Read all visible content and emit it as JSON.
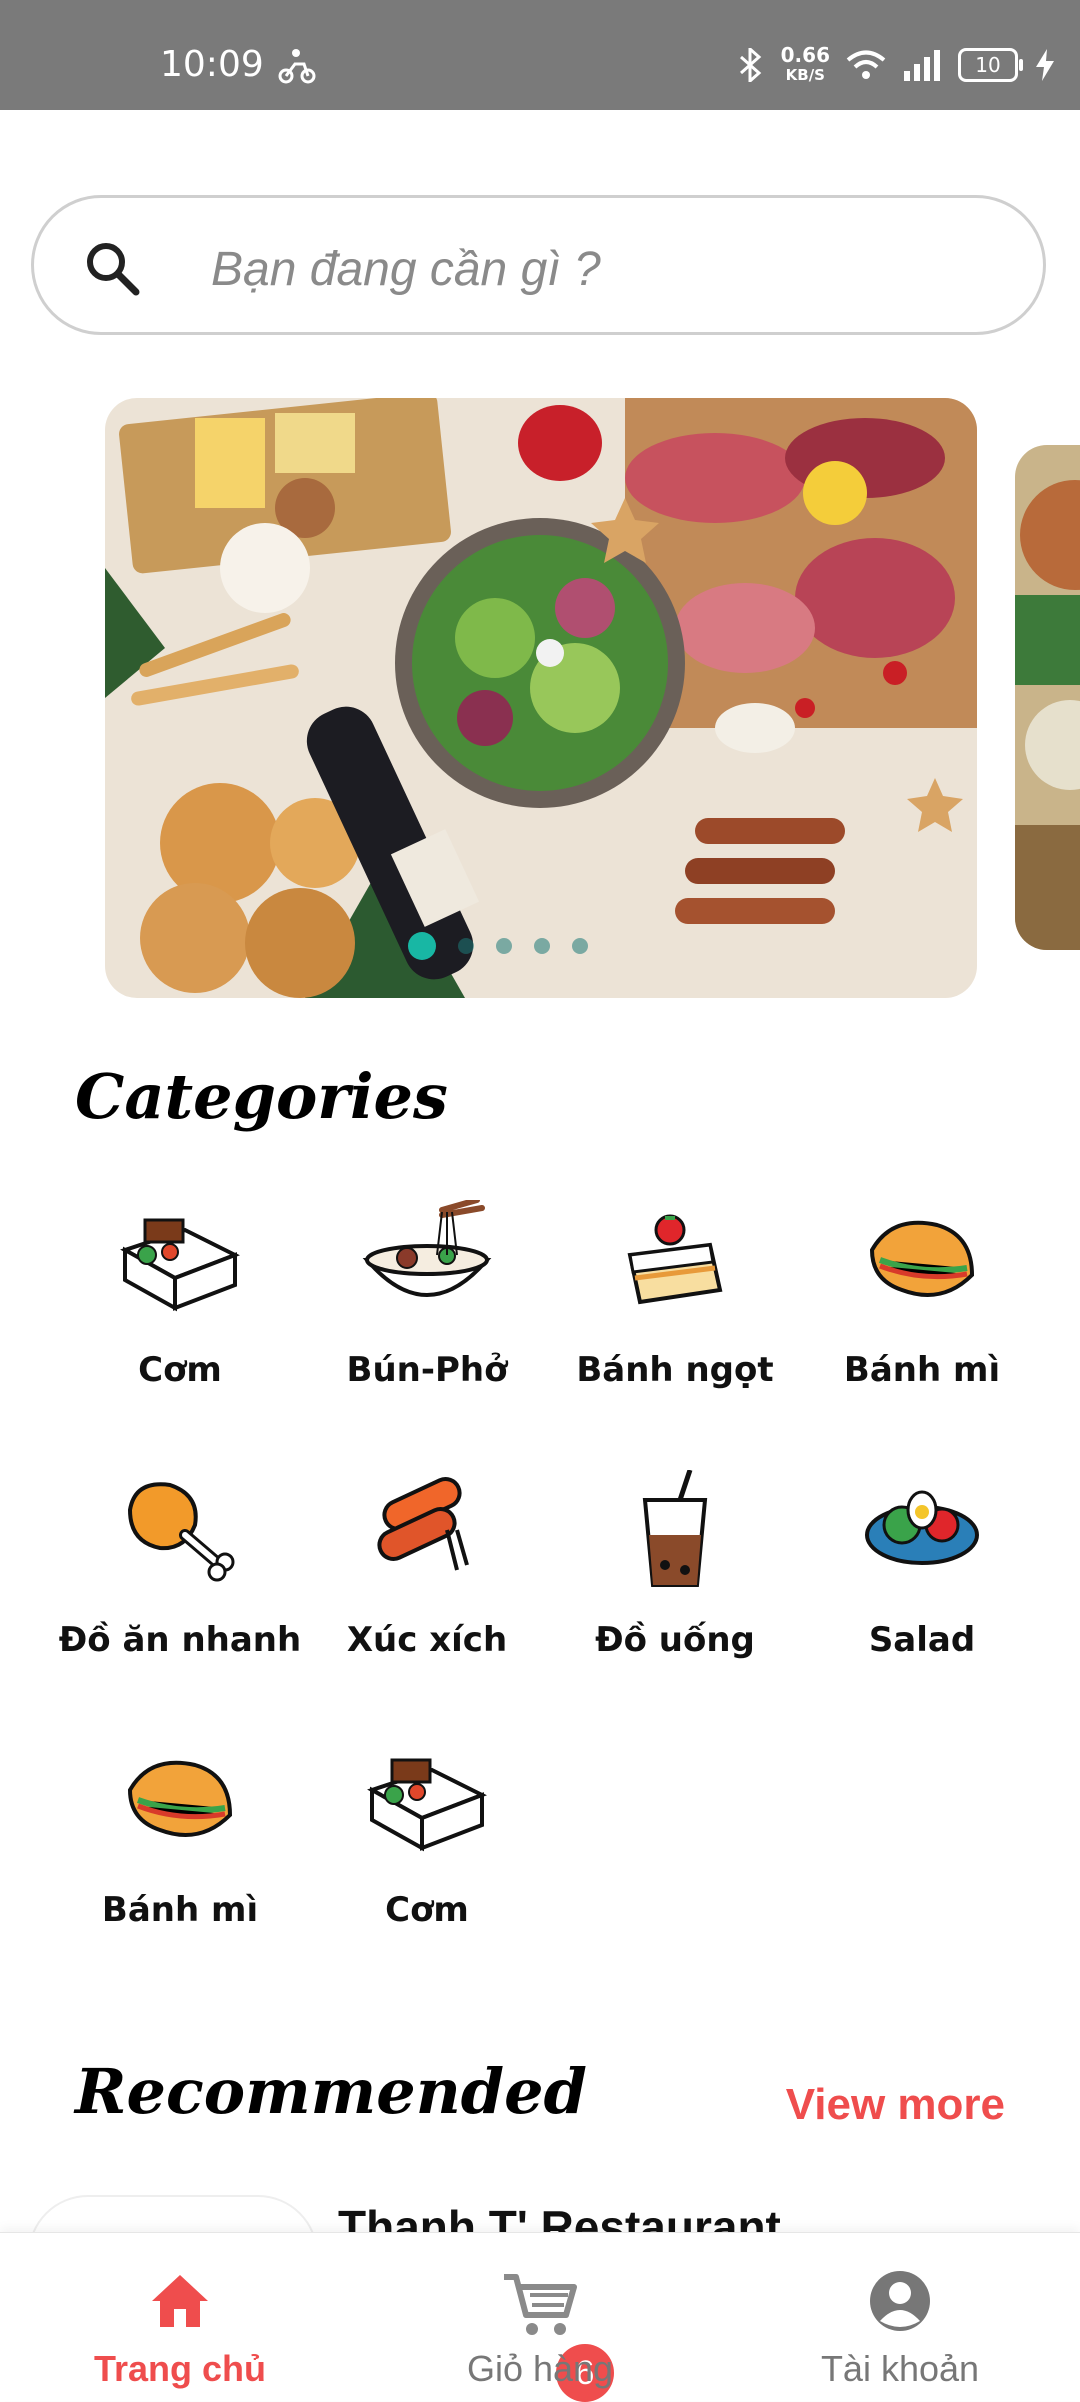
{
  "status_bar": {
    "time": "10:09",
    "speed_value": "0.66",
    "speed_unit": "KB/S",
    "battery": "10"
  },
  "search": {
    "placeholder": "Bạn đang cần gì ?"
  },
  "banner": {
    "slide_count": 5,
    "active_index": 0
  },
  "sections": {
    "categories_title": "Categories",
    "recommended_title": "Recommended",
    "view_more": "View more"
  },
  "categories": [
    {
      "label": "Cơm",
      "icon": "rice-box-icon"
    },
    {
      "label": "Bún-Phở",
      "icon": "noodle-bowl-icon"
    },
    {
      "label": "Bánh ngọt",
      "icon": "cake-icon"
    },
    {
      "label": "Bánh mì",
      "icon": "sandwich-icon"
    },
    {
      "label": "Đồ ăn nhanh",
      "icon": "chicken-leg-icon"
    },
    {
      "label": "Xúc xích",
      "icon": "sausage-icon"
    },
    {
      "label": "Đồ uống",
      "icon": "drink-icon"
    },
    {
      "label": "Salad",
      "icon": "salad-icon"
    },
    {
      "label": "Bánh mì",
      "icon": "sandwich-icon"
    },
    {
      "label": "Cơm",
      "icon": "rice-box-icon"
    }
  ],
  "recommended": [
    {
      "name": "Thanh T' Restaurant"
    }
  ],
  "bottom_nav": {
    "home": "Trang chủ",
    "cart": "Giỏ hàng",
    "account": "Tài khoản",
    "cart_badge": "6"
  },
  "colors": {
    "accent": "#ef4d4d",
    "status_bar": "#7a7a7a",
    "dot_active": "#18b7a4"
  }
}
